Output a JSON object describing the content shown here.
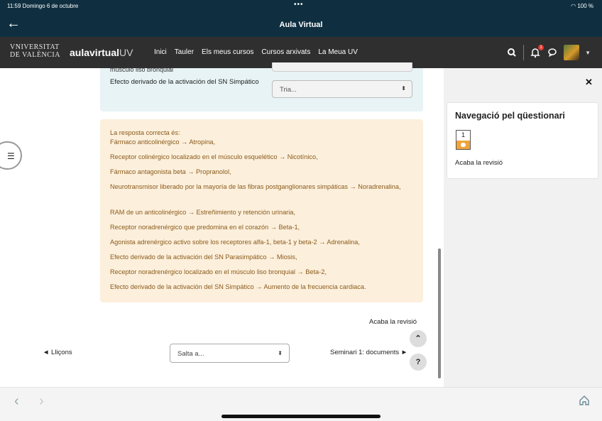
{
  "status": {
    "time_date": "11:59  Domingo 6 de octubre",
    "dots": "•••",
    "right": "100 %"
  },
  "app": {
    "title": "Aula Virtual"
  },
  "navbar": {
    "uv_logo_line1": "VNIVERSITAT",
    "uv_logo_line2": "DE VALÈNCIA",
    "aula_main": "aulavirtual",
    "aula_suffix": "UV",
    "menu": [
      "Inici",
      "Tauler",
      "Els meus cursos",
      "Cursos arxivats",
      "La Meua UV"
    ],
    "notif_count": "1"
  },
  "question": {
    "cut_label": "músculo liso bronquial",
    "label": "Efecto derivado de la activación del SN Simpático",
    "select_value": "Tria..."
  },
  "feedback": {
    "intro": "La resposta correcta és:",
    "lines": [
      "Fármaco anticolinérgico → Atropina,",
      "Receptor colinérgico localizado en el músculo esquelético → Nicotínico,",
      "Fármaco antagonista beta → Propranolol,",
      "Neurotransmisor liberado por la mayoría de las fibras postganglionares simpáticas → Noradrenalina,",
      "RAM de un anticolinérgico → Estreñimiento y retención urinaria,",
      "Receptor noradrenérgico que predomina en el corazón → Beta-1,",
      "Agonista adrenérgico activo sobre los receptores alfa-1, beta-1 y beta-2 → Adrenalina,",
      "Efecto derivado de la activación del SN Parasimpático → Miosis,",
      "Receptor noradrenérgico localizado en el músculo liso bronquial → Beta-2,",
      "Efecto derivado de la activación del SN Simpático → Aumento de la frecuencia cardiaca."
    ]
  },
  "footer_nav": {
    "finish_review": "Acaba la revisió",
    "prev": "◄ Lliçons",
    "jump_placeholder": "Salta a...",
    "next": "Seminari 1: documents ►",
    "help": "?"
  },
  "drawer": {
    "block_title": "Navegació pel qüestionari",
    "question_number": "1",
    "finish_review": "Acaba la revisió"
  },
  "colors": {
    "header": "#0f2f40",
    "navbar": "#2f2f2f",
    "feedback_bg": "#fcefdc",
    "question_bg": "#e7f3f5",
    "accent_orange": "#f0a43a"
  }
}
